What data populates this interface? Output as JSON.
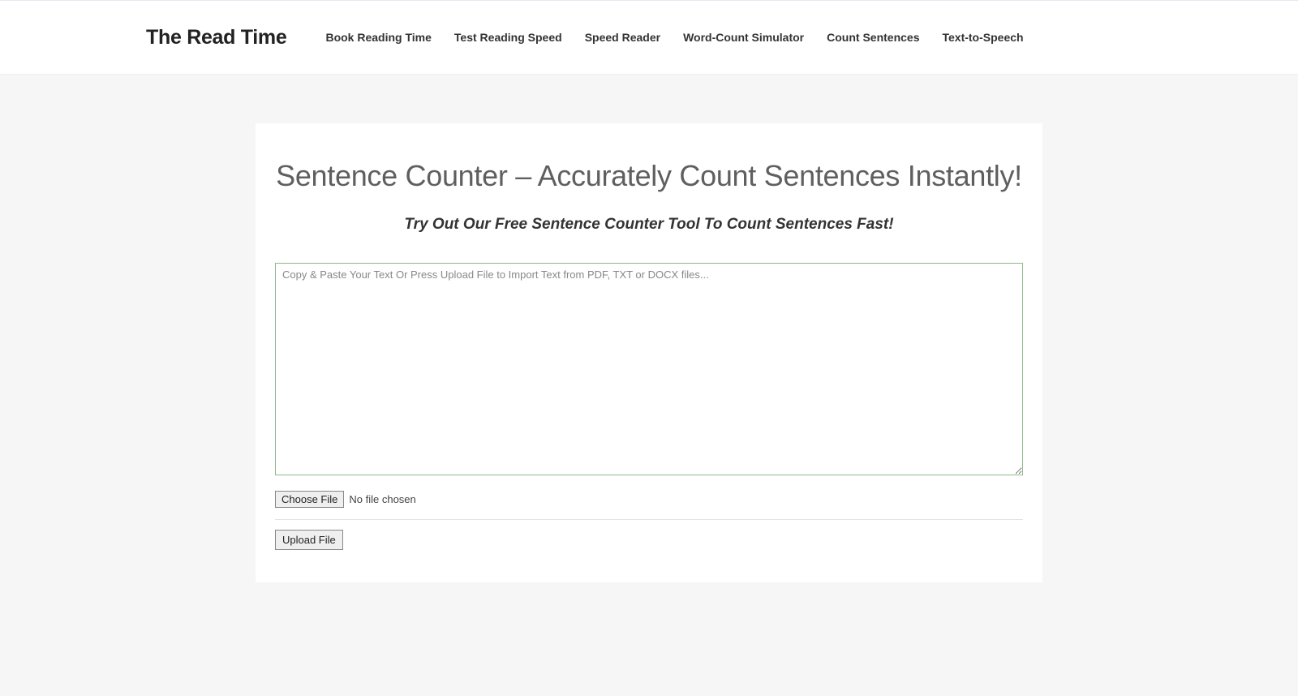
{
  "brand": "The Read Time",
  "nav": [
    "Book Reading Time",
    "Test Reading Speed",
    "Speed Reader",
    "Word-Count Simulator",
    "Count Sentences",
    "Text-to-Speech"
  ],
  "page_title": "Sentence Counter – Accurately Count Sentences Instantly!",
  "subtitle": "Try Out Our Free Sentence Counter Tool To Count Sentences Fast!",
  "textarea_placeholder": "Copy & Paste Your Text Or Press Upload File to Import Text from PDF, TXT or DOCX files...",
  "choose_file_label": "Choose File",
  "file_status": "No file chosen",
  "upload_label": "Upload File"
}
